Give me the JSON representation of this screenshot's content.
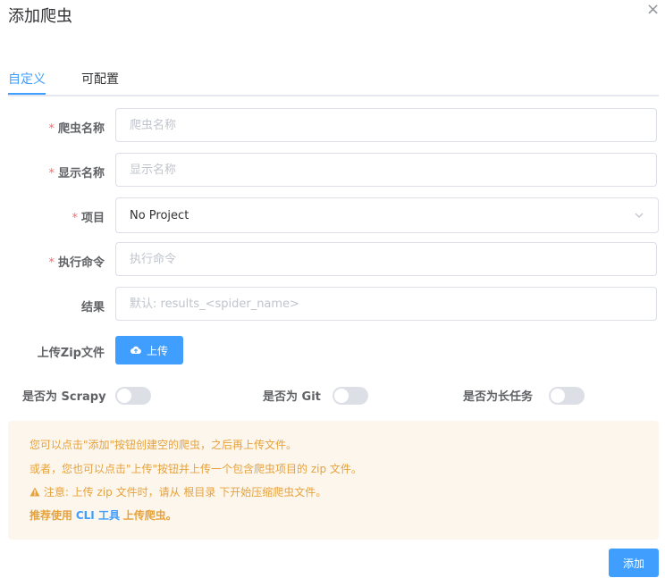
{
  "dialog": {
    "title": "添加爬虫",
    "close_glyph": "×"
  },
  "tabs": [
    {
      "label": "自定义",
      "active": true
    },
    {
      "label": "可配置",
      "active": false
    }
  ],
  "form": {
    "required_mark": "*",
    "spider_name": {
      "label": "爬虫名称",
      "placeholder": "爬虫名称",
      "value": ""
    },
    "display_name": {
      "label": "显示名称",
      "placeholder": "显示名称",
      "value": ""
    },
    "project": {
      "label": "项目",
      "value": "No Project"
    },
    "command": {
      "label": "执行命令",
      "placeholder": "执行命令",
      "value": ""
    },
    "results": {
      "label": "结果",
      "placeholder": "默认: results_<spider_name>",
      "value": ""
    },
    "upload_zip": {
      "label": "上传Zip文件",
      "button_label": "上传",
      "icon": "cloud-upload-icon"
    }
  },
  "switches": [
    {
      "label": "是否为 Scrapy",
      "on": false
    },
    {
      "label": "是否为 Git",
      "on": false
    },
    {
      "label": "是否为长任务",
      "on": false
    }
  ],
  "notice": {
    "line1": "您可以点击\"添加\"按钮创建空的爬虫，之后再上传文件。",
    "line2": "或者，您也可以点击\"上传\"按钮并上传一个包含爬虫项目的 zip 文件。",
    "line3": "注意: 上传 zip 文件时，请从 根目录 下开始压缩爬虫文件。",
    "line4_prefix": "推荐使用",
    "line4_link": "CLI 工具",
    "line4_suffix": "上传爬虫。",
    "warning_icon": "warning-icon"
  },
  "actions": {
    "add_label": "添加"
  },
  "colors": {
    "primary": "#409eff",
    "danger": "#f56c6c",
    "warning": "#e6a23c",
    "notice_bg": "#fdf6ec"
  }
}
